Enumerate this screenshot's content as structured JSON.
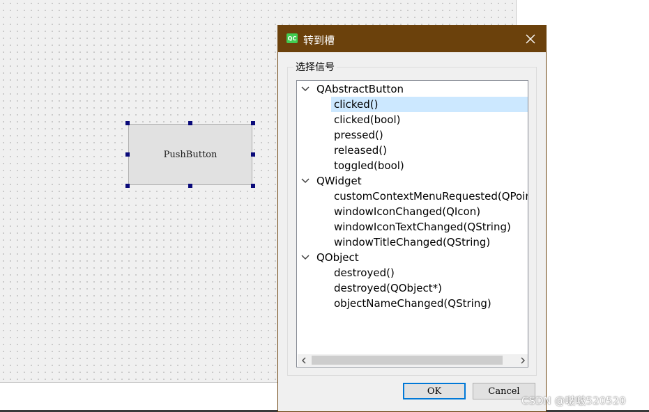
{
  "designer": {
    "push_button_label": "PushButton"
  },
  "dialog": {
    "title": "转到槽",
    "app_icon_text": "QC",
    "group_title": "选择信号",
    "tree": [
      {
        "type": "group",
        "label": "QAbstractButton"
      },
      {
        "type": "item",
        "label": "clicked()",
        "selected": true
      },
      {
        "type": "item",
        "label": "clicked(bool)"
      },
      {
        "type": "item",
        "label": "pressed()"
      },
      {
        "type": "item",
        "label": "released()"
      },
      {
        "type": "item",
        "label": "toggled(bool)"
      },
      {
        "type": "group",
        "label": "QWidget"
      },
      {
        "type": "item",
        "label": "customContextMenuRequested(QPoint)"
      },
      {
        "type": "item",
        "label": "windowIconChanged(QIcon)"
      },
      {
        "type": "item",
        "label": "windowIconTextChanged(QString)"
      },
      {
        "type": "item",
        "label": "windowTitleChanged(QString)"
      },
      {
        "type": "group",
        "label": "QObject"
      },
      {
        "type": "item",
        "label": "destroyed()"
      },
      {
        "type": "item",
        "label": "destroyed(QObject*)"
      },
      {
        "type": "item",
        "label": "objectNameChanged(QString)"
      }
    ],
    "ok_label": "OK",
    "cancel_label": "Cancel"
  },
  "watermark": "CSDN @啵啵520520",
  "colors": {
    "titlebar": "#6b410c",
    "selection": "#cce8ff",
    "qt_green": "#41cd52",
    "handle": "#0a0a7a"
  }
}
